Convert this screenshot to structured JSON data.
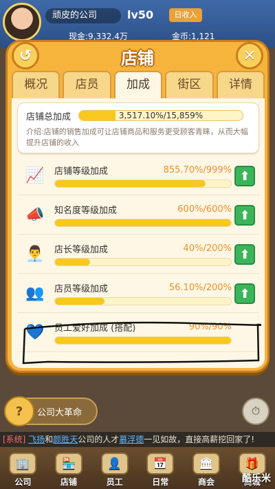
{
  "header": {
    "company_name": "顽皮的公司",
    "level": "lv50",
    "daily_income_label": "日收入",
    "cash_label": "现金:9,332.4万",
    "gold_label": "金币:1,121"
  },
  "panel": {
    "title": "店铺",
    "back_icon": "↺",
    "close_icon": "✕",
    "tabs": [
      {
        "label": "概况"
      },
      {
        "label": "店员"
      },
      {
        "label": "加成"
      },
      {
        "label": "街区"
      },
      {
        "label": "详情"
      }
    ],
    "active_tab": 2
  },
  "summary": {
    "label": "店铺总加成",
    "value_text": "3,517.10%/15,859%",
    "fill_fraction": 0.222,
    "desc": "介绍:店铺的销售加成可让店铺商品和服务更受顾客青睐，从而大幅提升店铺的收入"
  },
  "items": [
    {
      "name": "店铺等级加成",
      "value": "855.70%/999%",
      "fill": 0.857,
      "icon": "chart-icon"
    },
    {
      "name": "知名度等级加成",
      "value": "600%/600%",
      "fill": 1.0,
      "icon": "megaphone-icon"
    },
    {
      "name": "店长等级加成",
      "value": "40%/200%",
      "fill": 0.2,
      "icon": "manager-icon"
    },
    {
      "name": "店员等级加成",
      "value": "56.10%/200%",
      "fill": 0.28,
      "icon": "staff-icon"
    },
    {
      "name": "员工爱好加成 (搭配)",
      "value": "90%/90%",
      "fill": 1.0,
      "icon": "heart-icon"
    }
  ],
  "upgrade_icon": "⬆",
  "bottom": {
    "revolution_label": "公司大革命",
    "ticker_sys": "[系统]",
    "ticker_name1": "飞扬",
    "ticker_and": "和",
    "ticker_name2": "颜胜天",
    "ticker_mid": "公司的人才",
    "ticker_name3": "慕浮德",
    "ticker_tail": "一见如故，直接高薪挖回家了!",
    "nav": [
      {
        "label": "公司"
      },
      {
        "label": "店铺"
      },
      {
        "label": "员工"
      },
      {
        "label": "日常"
      },
      {
        "label": "商会"
      },
      {
        "label": "商城"
      }
    ],
    "watermark": "酷乐米"
  },
  "colors": {
    "panel_orange": "#f6b43d",
    "bar_yellow": "#f8c81e",
    "value_orange": "#e8912a",
    "upgrade_green": "#3cb55a"
  }
}
